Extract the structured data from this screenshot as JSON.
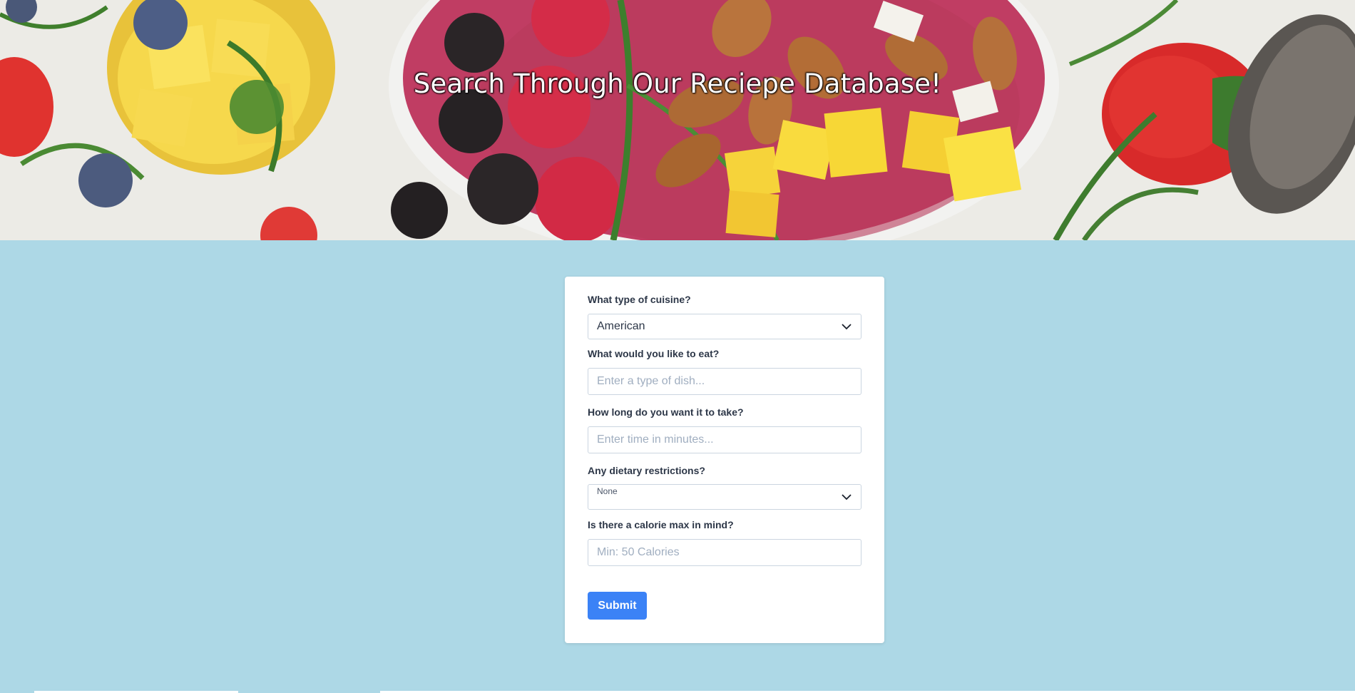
{
  "hero": {
    "title": "Search Through Our Reciepe Database!"
  },
  "form": {
    "cuisine": {
      "label": "What type of cuisine?",
      "selected": "American"
    },
    "dish": {
      "label": "What would you like to eat?",
      "placeholder": "Enter a type of dish...",
      "value": ""
    },
    "time": {
      "label": "How long do you want it to take?",
      "placeholder": "Enter time in minutes...",
      "value": ""
    },
    "diet": {
      "label": "Any dietary restrictions?",
      "selected": "None"
    },
    "calories": {
      "label": "Is there a calorie max in mind?",
      "placeholder": "Min: 50 Calories",
      "value": ""
    },
    "submit_label": "Submit"
  },
  "icons": {
    "cuisine_dropdown": "chevron-down-icon",
    "diet_dropdown": "chevron-down-icon"
  },
  "colors": {
    "page_background": "#ADD8E6",
    "card_background": "#FFFFFF",
    "submit_button": "#3B82F6",
    "label_text": "#2D3748",
    "placeholder_text": "#A0AEC0"
  }
}
